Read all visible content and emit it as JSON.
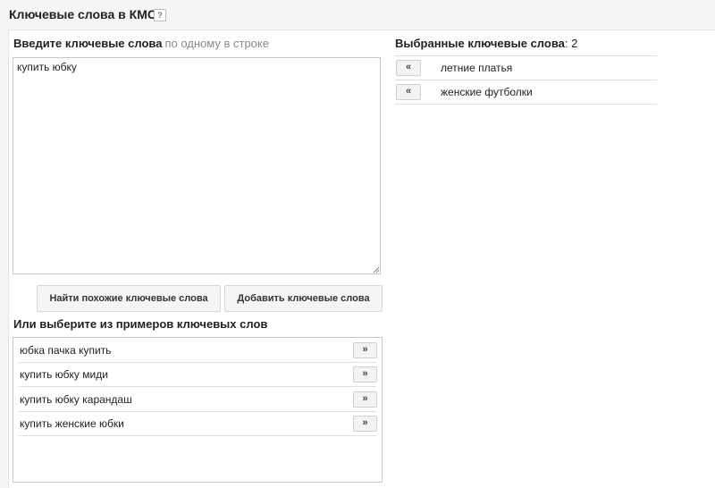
{
  "header": {
    "title": "Ключевые слова в КМС",
    "help_icon": "?"
  },
  "entry": {
    "label": "Введите ключевые слова",
    "hint": "по одному в строке",
    "textarea_value": "купить юбку"
  },
  "buttons": {
    "find_similar": "Найти похожие ключевые слова",
    "add_keywords": "Добавить ключевые слова"
  },
  "examples": {
    "label": "Или выберите из примеров ключевых слов",
    "add_symbol": "»",
    "items": [
      "юбка пачка купить",
      "купить юбку миди",
      "купить юбку карандаш",
      "купить женские юбки"
    ]
  },
  "selected": {
    "label": "Выбранные ключевые слова",
    "count_text": ": 2",
    "remove_symbol": "«",
    "items": [
      "летние платья",
      "женские футболки"
    ]
  }
}
